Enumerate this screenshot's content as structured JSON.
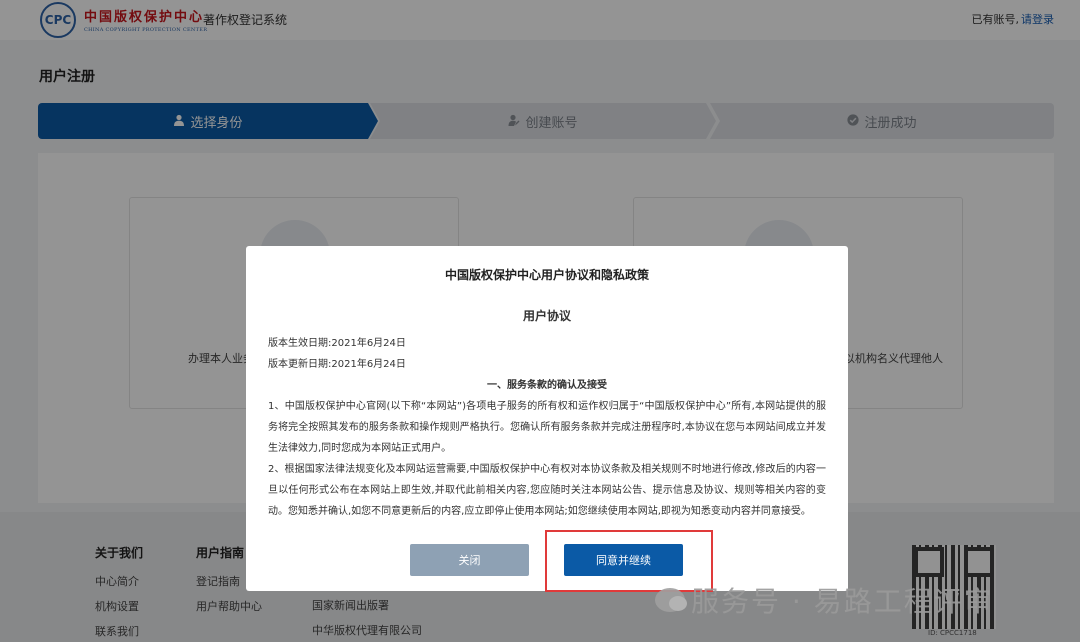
{
  "header": {
    "logo_mark": "CPC",
    "logo_cn": "中国版权保护中心",
    "logo_en": "CHINA COPYRIGHT PROTECTION CENTER",
    "system_name": "著作权登记系统",
    "login_hint": "已有账号,",
    "login_link": "请登录"
  },
  "page": {
    "title": "用户注册"
  },
  "steps": [
    {
      "label": "选择身份",
      "icon": "user-icon",
      "active": true
    },
    {
      "label": "创建账号",
      "icon": "user-edit-icon",
      "active": false
    },
    {
      "label": "注册成功",
      "icon": "check-circle-icon",
      "active": false
    }
  ],
  "identity_cards": [
    {
      "text": "办理本人业务"
    },
    {
      "text": "以机构名义代理他人"
    }
  ],
  "footer": {
    "col1": {
      "head": "关于我们",
      "items": [
        "中心简介",
        "机构设置",
        "联系我们"
      ]
    },
    "col2": {
      "head": "用户指南",
      "items": [
        "登记指南",
        "用户帮助中心"
      ]
    },
    "col3": {
      "items": [
        "国家新闻出版署",
        "中华版权代理有限公司"
      ]
    },
    "qr_caption": "ID: CPCC1718"
  },
  "modal": {
    "title": "中国版权保护中心用户协议和隐私政策",
    "section_title": "用户协议",
    "effective_date": "版本生效日期:2021年6月24日",
    "update_date": "版本更新日期:2021年6月24日",
    "clause_title": "一、服务条款的确认及接受",
    "para1": "1、中国版权保护中心官网(以下称“本网站”)各项电子服务的所有权和运作权归属于“中国版权保护中心”所有,本网站提供的服务将完全按照其发布的服务条款和操作规则严格执行。您确认所有服务条款并完成注册程序时,本协议在您与本网站间成立并发生法律效力,同时您成为本网站正式用户。",
    "para2": "2、根据国家法律法规变化及本网站运营需要,中国版权保护中心有权对本协议条款及相关规则不时地进行修改,修改后的内容一旦以任何形式公布在本网站上即生效,并取代此前相关内容,您应随时关注本网站公告、提示信息及协议、规则等相关内容的变动。您知悉并确认,如您不同意更新后的内容,应立即停止使用本网站;如您继续使用本网站,即视为知悉变动内容并同意接受。",
    "close_label": "关闭",
    "agree_label": "同意并继续"
  },
  "watermark": {
    "text": "服务号 · 易路工程评审"
  },
  "colors": {
    "primary": "#0b5aa6",
    "close_button": "#8ea1b4",
    "highlight": "#e03a3a",
    "brand_red": "#c8161d"
  }
}
